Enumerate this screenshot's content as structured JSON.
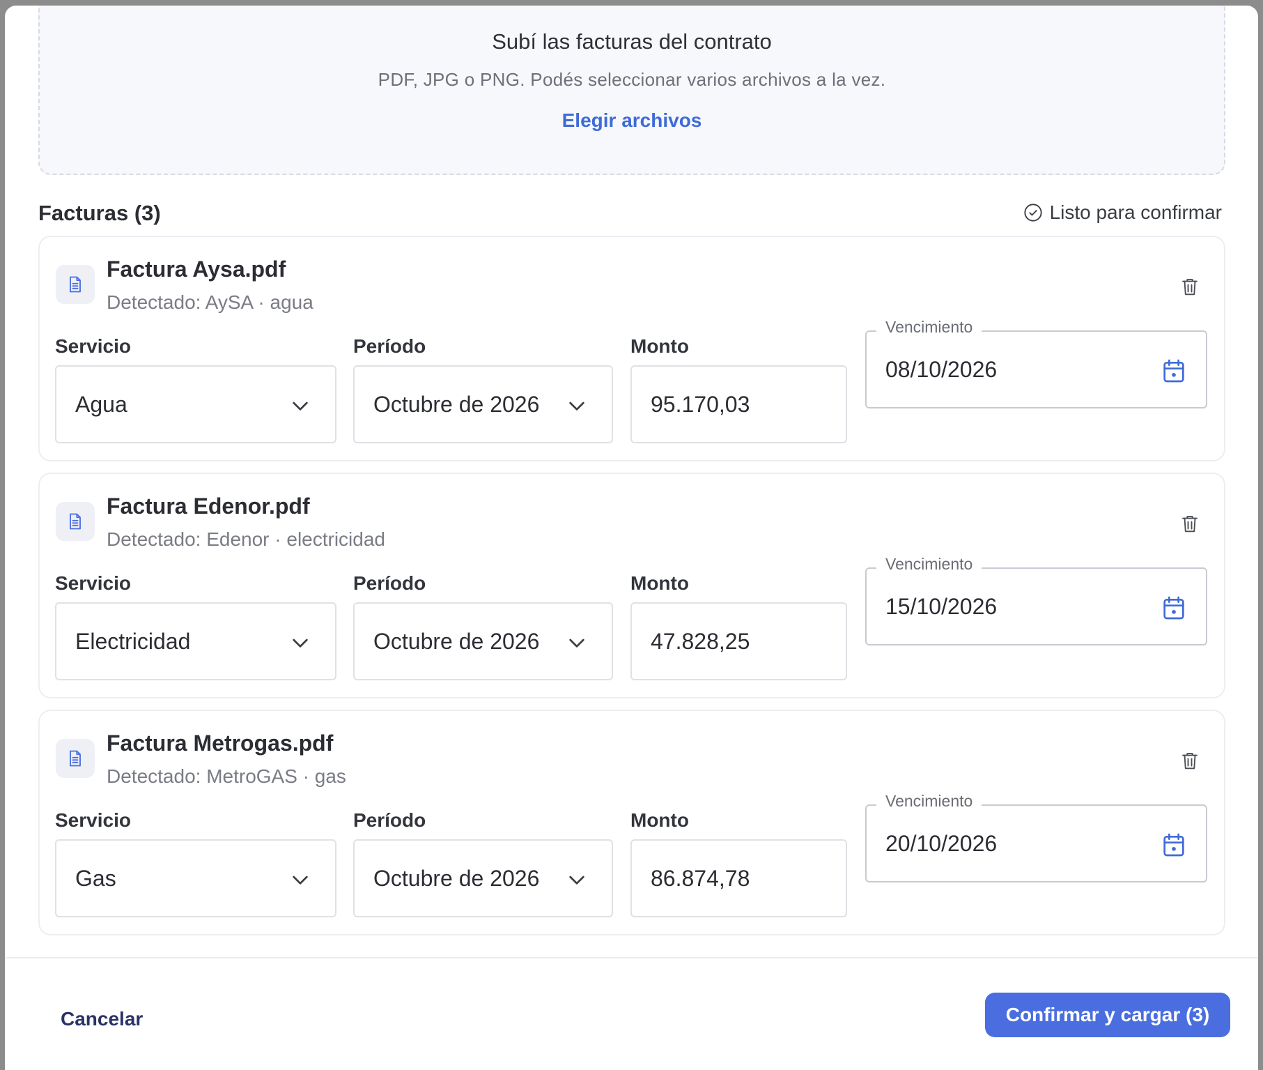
{
  "upload": {
    "title": "Subí las facturas del contrato",
    "subtitle": "PDF, JPG o PNG. Podés seleccionar varios archivos a la vez.",
    "choose_label": "Elegir archivos"
  },
  "invoices_section": {
    "title": "Facturas (3)",
    "status": "Listo para confirmar"
  },
  "labels": {
    "servicio": "Servicio",
    "periodo": "Período",
    "monto": "Monto",
    "vencimiento": "Vencimiento"
  },
  "invoices": [
    {
      "file_name": "Factura Aysa.pdf",
      "detected": "Detectado: AySA · agua",
      "servicio": "Agua",
      "periodo": "Octubre de 2026",
      "monto": "95.170,03",
      "vencimiento": "08/10/2026"
    },
    {
      "file_name": "Factura Edenor.pdf",
      "detected": "Detectado: Edenor · electricidad",
      "servicio": "Electricidad",
      "periodo": "Octubre de 2026",
      "monto": "47.828,25",
      "vencimiento": "15/10/2026"
    },
    {
      "file_name": "Factura Metrogas.pdf",
      "detected": "Detectado: MetroGAS · gas",
      "servicio": "Gas",
      "periodo": "Octubre de 2026",
      "monto": "86.874,78",
      "vencimiento": "20/10/2026"
    }
  ],
  "footer": {
    "cancel_label": "Cancelar",
    "confirm_label": "Confirmar y cargar (3)"
  },
  "colors": {
    "accent": "#4a6ee0",
    "link": "#3f6bd8",
    "cancel_text": "#2a3368"
  }
}
